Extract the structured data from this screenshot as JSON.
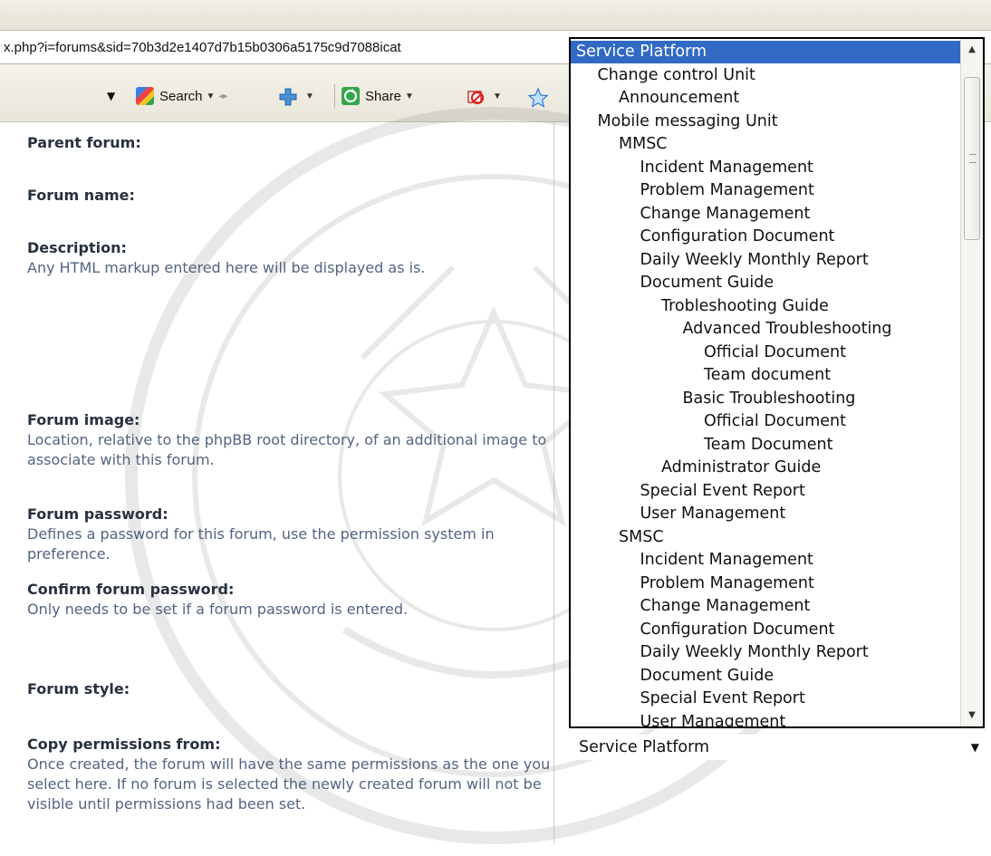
{
  "browser": {
    "address": "x.php?i=forums&sid=70b3d2e1407d7b15b0306a5175c9d7088icat",
    "toolbar": {
      "search_label": "Search",
      "share_label": "Share"
    }
  },
  "form": {
    "fields": [
      {
        "label": "Parent forum:",
        "help": ""
      },
      {
        "label": "Forum name:",
        "help": ""
      },
      {
        "label": "Description:",
        "help": "Any HTML markup entered here will be displayed as is."
      },
      {
        "label": "Forum image:",
        "help": "Location, relative to the phpBB root directory, of an additional image to associate with this forum."
      },
      {
        "label": "Forum password:",
        "help": "Defines a password for this forum, use the permission system in preference."
      },
      {
        "label": "Confirm forum password:",
        "help": "Only needs to be set if a forum password is entered."
      },
      {
        "label": "Forum style:",
        "help": ""
      },
      {
        "label": "Copy permissions from:",
        "help": "Once created, the forum will have the same permissions as the one you select here. If no forum is selected the newly created forum will not be visible until permissions had been set."
      }
    ]
  },
  "parent_forum_list": {
    "selected_value": "Service Platform",
    "options": [
      {
        "label": "Service Platform",
        "level": 0,
        "selected": true
      },
      {
        "label": "Change control Unit",
        "level": 1
      },
      {
        "label": "Announcement",
        "level": 2
      },
      {
        "label": "Mobile messaging Unit",
        "level": 1
      },
      {
        "label": "MMSC",
        "level": 2
      },
      {
        "label": "Incident Management",
        "level": 3
      },
      {
        "label": "Problem Management",
        "level": 3
      },
      {
        "label": "Change Management",
        "level": 3
      },
      {
        "label": "Configuration Document",
        "level": 3
      },
      {
        "label": "Daily Weekly Monthly Report",
        "level": 3
      },
      {
        "label": "Document Guide",
        "level": 3
      },
      {
        "label": "Trobleshooting Guide",
        "level": 4
      },
      {
        "label": "Advanced Troubleshooting",
        "level": 5
      },
      {
        "label": "Official Document",
        "level": 6
      },
      {
        "label": "Team document",
        "level": 6
      },
      {
        "label": "Basic Troubleshooting",
        "level": 5
      },
      {
        "label": "Official Document",
        "level": 6
      },
      {
        "label": "Team Document",
        "level": 6
      },
      {
        "label": "Administrator Guide",
        "level": 4
      },
      {
        "label": "Special Event Report",
        "level": 3
      },
      {
        "label": "User Management",
        "level": 3
      },
      {
        "label": "SMSC",
        "level": 2
      },
      {
        "label": "Incident Management",
        "level": 3
      },
      {
        "label": "Problem Management",
        "level": 3
      },
      {
        "label": "Change Management",
        "level": 3
      },
      {
        "label": "Configuration Document",
        "level": 3
      },
      {
        "label": "Daily Weekly Monthly Report",
        "level": 3
      },
      {
        "label": "Document Guide",
        "level": 3
      },
      {
        "label": "Special Event Report",
        "level": 3
      },
      {
        "label": "User Management",
        "level": 3
      }
    ]
  },
  "colors": {
    "selection": "#316ac5",
    "label_text": "#28313f",
    "help_text": "#536482"
  },
  "icons": [
    "dropdown-arrow-icon",
    "search-engine-icon",
    "plus-icon",
    "share-icon",
    "blocked-icon",
    "favorite-star-icon",
    "scroll-up-icon",
    "scroll-down-icon",
    "university-seal-watermark"
  ]
}
